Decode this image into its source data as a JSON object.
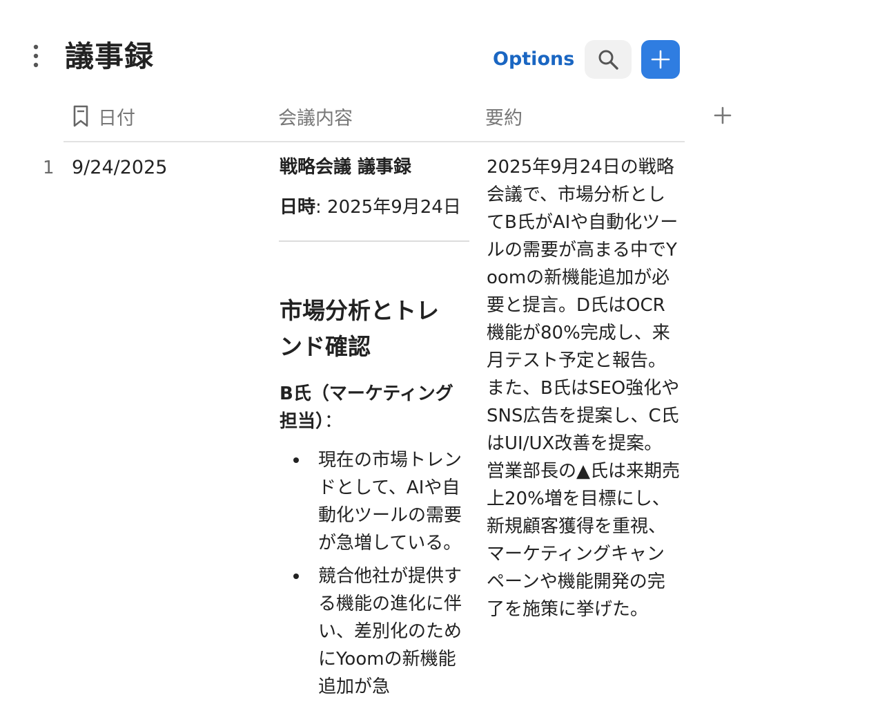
{
  "header": {
    "title": "議事録",
    "options_label": "Options"
  },
  "columns": {
    "date": "日付",
    "content": "会議内容",
    "summary": "要約"
  },
  "row": {
    "number": "1",
    "date": "9/24/2025",
    "content": {
      "title": "戦略会議 議事録",
      "date_label": "日時",
      "date_value": ": 2025年9月24日",
      "section_heading": "市場分析とトレンド確認",
      "speaker_name": "B氏（マーケティング担当）",
      "speaker_suffix": "：",
      "bullets": [
        "現在の市場トレンドとして、AIや自動化ツールの需要が急増している。",
        "競合他社が提供する機能の進化に伴い、差別化のためにYoomの新機能追加が急"
      ]
    },
    "summary": "2025年9月24日の戦略会議で、市場分析としてB氏がAIや自動化ツールの需要が高まる中でYoomの新機能追加が必要と提言。D氏はOCR機能が80%完成し、来月テスト予定と報告。また、B氏はSEO強化やSNS広告を提案し、C氏はUI/UX改善を提案。営業部長の▲氏は来期売上20%増を目標にし、新規顧客獲得を重視、マーケティングキャンペーンや機能開発の完了を施策に挙げた。"
  },
  "icons": {
    "menu": "kebab-menu-icon",
    "search": "search-icon",
    "add": "plus-icon",
    "date_column": "bookmark-icon",
    "add_column": "plus-icon"
  },
  "colors": {
    "accent": "#2f7de1",
    "link": "#1a66c2",
    "muted": "#777777"
  }
}
